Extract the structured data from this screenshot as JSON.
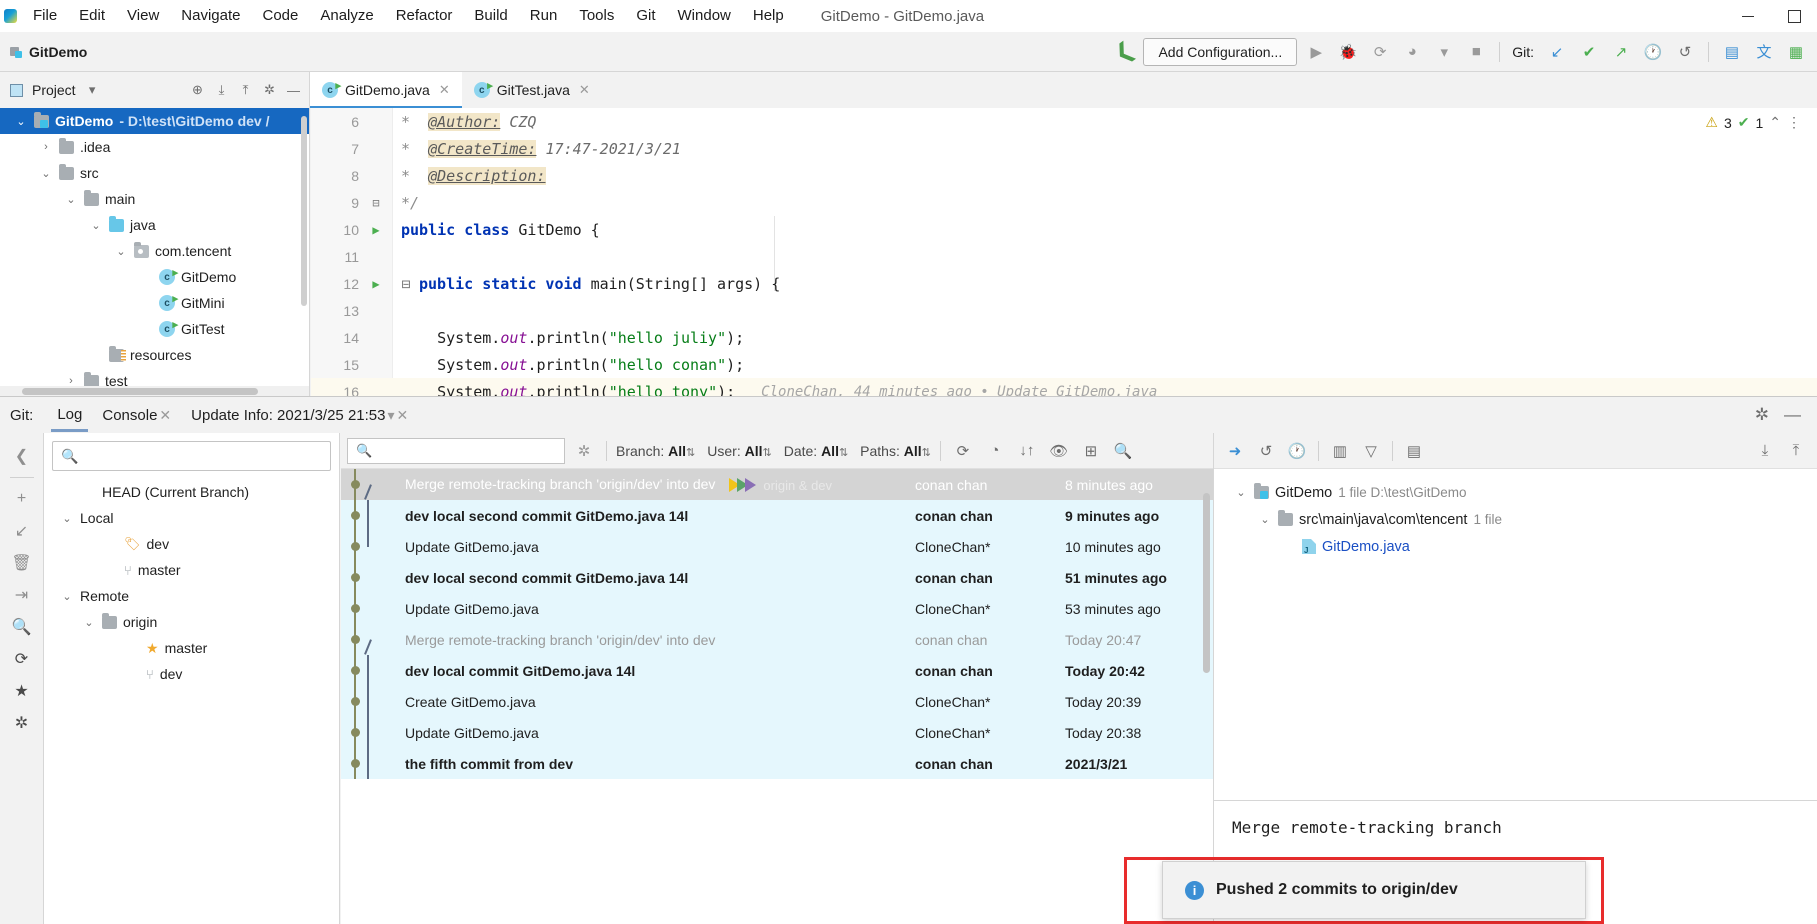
{
  "window": {
    "title": "GitDemo - GitDemo.java",
    "minimize": "–",
    "maximize": "□"
  },
  "menubar": {
    "items": [
      {
        "label": "File"
      },
      {
        "label": "Edit"
      },
      {
        "label": "View"
      },
      {
        "label": "Navigate"
      },
      {
        "label": "Code"
      },
      {
        "label": "Analyze"
      },
      {
        "label": "Refactor"
      },
      {
        "label": "Build"
      },
      {
        "label": "Run"
      },
      {
        "label": "Tools"
      },
      {
        "label": "Git"
      },
      {
        "label": "Window"
      },
      {
        "label": "Help"
      }
    ]
  },
  "toolbar": {
    "project_name": "GitDemo",
    "add_configuration": "Add Configuration...",
    "git_label": "Git:",
    "icons": [
      "run-icon",
      "debug-icon",
      "run-coverage-icon",
      "profile-icon",
      "dropdown-icon",
      "stop-icon",
      "git-update-icon",
      "git-commit-icon",
      "git-push-icon",
      "git-history-icon",
      "git-rollback-icon",
      "search-everywhere-icon",
      "translate-icon",
      "database-icon"
    ]
  },
  "project_panel": {
    "header": "Project",
    "tree": [
      {
        "label": "GitDemo",
        "path": "- D:\\test\\GitDemo dev /",
        "indent": 0,
        "icon": "module-icon",
        "chevron": "v",
        "selected": true,
        "bold": true
      },
      {
        "label": ".idea",
        "path": "",
        "indent": 1,
        "icon": "folder-icon",
        "chevron": ">",
        "selected": false,
        "bold": false
      },
      {
        "label": "src",
        "path": "",
        "indent": 1,
        "icon": "folder-icon",
        "chevron": "v",
        "selected": false,
        "bold": false
      },
      {
        "label": "main",
        "path": "",
        "indent": 2,
        "icon": "folder-icon",
        "chevron": "v",
        "selected": false,
        "bold": false
      },
      {
        "label": "java",
        "path": "",
        "indent": 3,
        "icon": "source-folder-icon",
        "chevron": "v",
        "selected": false,
        "bold": false
      },
      {
        "label": "com.tencent",
        "path": "",
        "indent": 4,
        "icon": "package-icon",
        "chevron": "v",
        "selected": false,
        "bold": false
      },
      {
        "label": "GitDemo",
        "path": "",
        "indent": 5,
        "icon": "java-class-icon",
        "chevron": "",
        "selected": false,
        "bold": false
      },
      {
        "label": "GitMini",
        "path": "",
        "indent": 5,
        "icon": "java-class-icon",
        "chevron": "",
        "selected": false,
        "bold": false
      },
      {
        "label": "GitTest",
        "path": "",
        "indent": 5,
        "icon": "java-class-icon",
        "chevron": "",
        "selected": false,
        "bold": false
      },
      {
        "label": "resources",
        "path": "",
        "indent": 3,
        "icon": "resource-folder-icon",
        "chevron": "",
        "selected": false,
        "bold": false
      },
      {
        "label": "test",
        "path": "",
        "indent": 2,
        "icon": "folder-icon",
        "chevron": ">",
        "selected": false,
        "bold": false
      }
    ]
  },
  "editor": {
    "tabs": [
      {
        "label": "GitDemo.java",
        "active": true
      },
      {
        "label": "GitTest.java",
        "active": false
      }
    ],
    "inspection": {
      "warnings": "3",
      "ok": "1"
    },
    "lines": [
      {
        "num": "6",
        "text": " *  @Author: CZQ"
      },
      {
        "num": "7",
        "text": " *  @CreateTime: 17:47-2021/3/21"
      },
      {
        "num": "8",
        "text": " *  @Description:"
      },
      {
        "num": "9",
        "text": " */"
      },
      {
        "num": "10",
        "text": "public class GitDemo {"
      },
      {
        "num": "11",
        "text": ""
      },
      {
        "num": "12",
        "text": "    public static void main(String[] args) {"
      },
      {
        "num": "13",
        "text": ""
      },
      {
        "num": "14",
        "text": "        System.out.println(\"hello juliy\");"
      },
      {
        "num": "15",
        "text": "        System.out.println(\"hello conan\");"
      },
      {
        "num": "16",
        "text": "        System.out.println(\"hello tony\");"
      }
    ],
    "code": {
      "author_tag": "@Author:",
      "author_val": "CZQ",
      "createtime_tag": "@CreateTime:",
      "createtime_val": "17:47-2021/3/21",
      "description_tag": "@Description:",
      "comment_end": "*/",
      "class_decl_kw1": "public",
      "class_decl_kw2": "class",
      "class_decl_name": "GitDemo {",
      "main_kw": "public static void",
      "main_sig": "main(String[] args) {",
      "print_juliy": "hello juliy",
      "print_conan": "hello conan",
      "print_tony": "hello tony",
      "sysout_prefix": "System.",
      "sysout_field": "out",
      "sysout_call": ".println("
    },
    "blame": "CloneChan, 44 minutes ago • Update GitDemo.java"
  },
  "git_window": {
    "label": "Git:",
    "tabs": [
      {
        "label": "Log",
        "active": true,
        "closable": false
      },
      {
        "label": "Console",
        "active": false,
        "closable": true
      },
      {
        "label": "Update Info: 2021/3/25 21:53",
        "active": false,
        "closable": true,
        "dropdown": true
      }
    ],
    "rail_icons": [
      "collapse-left-icon",
      "add-icon",
      "fetch-icon",
      "delete-icon",
      "collapse-all-icon",
      "search-icon",
      "refresh-icon",
      "favorite-icon",
      "settings-icon"
    ],
    "branch_search_placeholder": "",
    "branch_tree": [
      {
        "label": "HEAD (Current Branch)",
        "indent": 1,
        "icon": "",
        "chevron": ""
      },
      {
        "label": "Local",
        "indent": 0,
        "icon": "",
        "chevron": "v"
      },
      {
        "label": "dev",
        "indent": 2,
        "icon": "tag-icon",
        "chevron": ""
      },
      {
        "label": "master",
        "indent": 2,
        "icon": "branch-icon",
        "chevron": ""
      },
      {
        "label": "Remote",
        "indent": 0,
        "icon": "",
        "chevron": "v"
      },
      {
        "label": "origin",
        "indent": 1,
        "icon": "folder-icon",
        "chevron": "v"
      },
      {
        "label": "master",
        "indent": 3,
        "icon": "star-icon",
        "chevron": ""
      },
      {
        "label": "dev",
        "indent": 3,
        "icon": "branch-icon",
        "chevron": ""
      }
    ],
    "log_search_placeholder": "",
    "filters": [
      {
        "name": "Branch",
        "value": "All"
      },
      {
        "name": "User",
        "value": "All"
      },
      {
        "name": "Date",
        "value": "All"
      },
      {
        "name": "Paths",
        "value": "All"
      }
    ],
    "log_toolbar_icons": [
      "refresh-icon",
      "intellisort-icon",
      "sort-icon",
      "show-details-icon",
      "show-diff-icon",
      "search-icon"
    ],
    "commits": [
      {
        "subject": "Merge remote-tracking branch 'origin/dev' into dev",
        "author": "conan chan",
        "date": "8 minutes ago",
        "refs": "origin & dev",
        "selected": true,
        "bold": false,
        "muted": false
      },
      {
        "subject": "dev local second  commit GitDemo.java 14l",
        "author": "conan chan",
        "date": "9 minutes ago",
        "refs": "",
        "selected": false,
        "bold": true,
        "muted": false
      },
      {
        "subject": "Update GitDemo.java",
        "author": "CloneChan*",
        "date": "10 minutes ago",
        "refs": "",
        "selected": false,
        "bold": false,
        "muted": false
      },
      {
        "subject": "dev local second  commit GitDemo.java 14l",
        "author": "conan chan",
        "date": "51 minutes ago",
        "refs": "",
        "selected": false,
        "bold": true,
        "muted": false
      },
      {
        "subject": "Update GitDemo.java",
        "author": "CloneChan*",
        "date": "53 minutes ago",
        "refs": "",
        "selected": false,
        "bold": false,
        "muted": false
      },
      {
        "subject": "Merge remote-tracking branch 'origin/dev' into dev",
        "author": "conan chan",
        "date": "Today 20:47",
        "refs": "",
        "selected": false,
        "bold": false,
        "muted": true
      },
      {
        "subject": "dev local commit GitDemo.java 14l",
        "author": "conan chan",
        "date": "Today 20:42",
        "refs": "",
        "selected": false,
        "bold": true,
        "muted": false
      },
      {
        "subject": "Create GitDemo.java",
        "author": "CloneChan*",
        "date": "Today 20:39",
        "refs": "",
        "selected": false,
        "bold": false,
        "muted": false
      },
      {
        "subject": "Update GitDemo.java",
        "author": "CloneChan*",
        "date": "Today 20:38",
        "refs": "",
        "selected": false,
        "bold": false,
        "muted": false
      },
      {
        "subject": "the fifth commit  from dev",
        "author": "conan chan",
        "date": "2021/3/21",
        "refs": "",
        "selected": false,
        "bold": true,
        "muted": false
      }
    ],
    "details_toolbar_icons": [
      "jump-to-source-icon",
      "revert-icon",
      "history-icon",
      "group-by-icon",
      "filter-icon",
      "view-options-icon",
      "expand-all-icon",
      "collapse-all-icon"
    ],
    "changed_files": [
      {
        "label": "GitDemo",
        "meta": "1 file  D:\\test\\GitDemo",
        "indent": 0,
        "icon": "module-icon",
        "chevron": "v",
        "link": false
      },
      {
        "label": "src\\main\\java\\com\\tencent",
        "meta": "1 file",
        "indent": 1,
        "icon": "folder-icon",
        "chevron": "v",
        "link": false
      },
      {
        "label": "GitDemo.java",
        "meta": "",
        "indent": 2,
        "icon": "java-file-icon",
        "chevron": "",
        "link": true
      }
    ],
    "commit_message": "Merge remote-tracking branch"
  },
  "notification": {
    "text": "Pushed 2 commits to origin/dev",
    "icon": "info-icon",
    "border_color": "#e82c2c"
  },
  "colors": {
    "accent": "#3b8fd4",
    "selection": "#1668c1",
    "log_row": "#e5f7fd",
    "log_selected": "#d4d4d4",
    "keyword": "#0033b3",
    "string": "#067d17",
    "alert": "#e82c2c"
  }
}
